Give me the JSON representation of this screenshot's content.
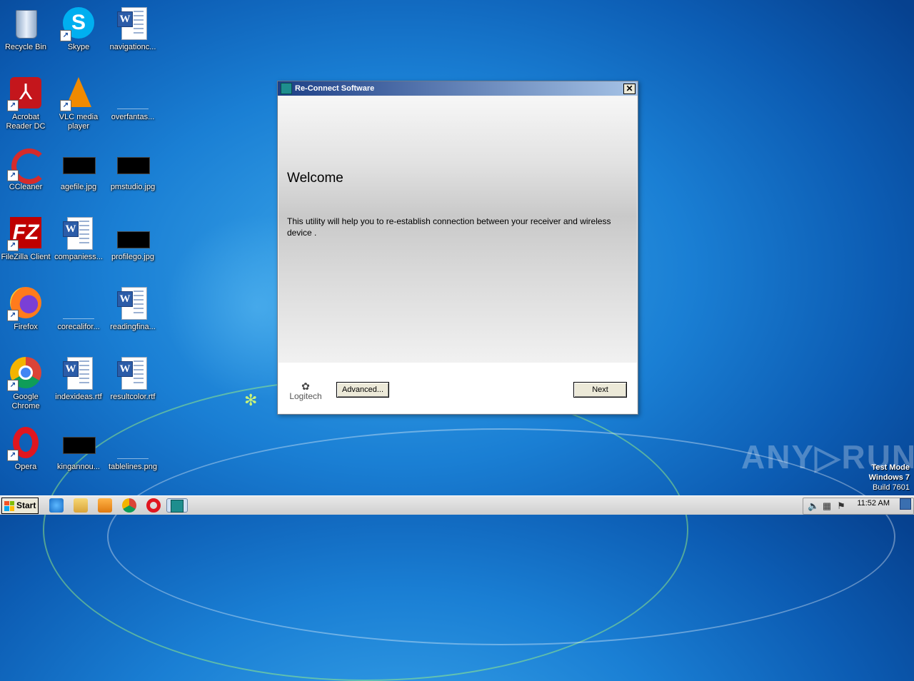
{
  "desktop_icons": [
    {
      "label": "Recycle Bin"
    },
    {
      "label": "Skype"
    },
    {
      "label": "navigationc..."
    },
    {
      "label": "Acrobat Reader DC"
    },
    {
      "label": "VLC media player"
    },
    {
      "label": "overfantas..."
    },
    {
      "label": "CCleaner"
    },
    {
      "label": "agefile.jpg"
    },
    {
      "label": "pmstudio.jpg"
    },
    {
      "label": "FileZilla Client"
    },
    {
      "label": "companiess..."
    },
    {
      "label": "profilego.jpg"
    },
    {
      "label": "Firefox"
    },
    {
      "label": "corecalifor..."
    },
    {
      "label": "readingfina..."
    },
    {
      "label": "Google Chrome"
    },
    {
      "label": "indexideas.rtf"
    },
    {
      "label": "resultcolor.rtf"
    },
    {
      "label": "Opera"
    },
    {
      "label": "kingannou..."
    },
    {
      "label": "tablelines.png"
    }
  ],
  "dialog": {
    "title": "Re-Connect Software",
    "close_glyph": "✕",
    "heading": "Welcome",
    "description": "This utility will help you to re-establish connection between your receiver and wireless device .",
    "logo_text": "Logitech",
    "advanced_label": "Advanced...",
    "next_label": "Next"
  },
  "watermark": {
    "text": "ANY▷RUN"
  },
  "system": {
    "line1": "Test Mode",
    "line2": "Windows 7",
    "line3": "Build 7601"
  },
  "taskbar": {
    "start_label": "Start",
    "clock": "11:52 AM"
  },
  "colors": {
    "desktop": "#1a7fd4",
    "titlebar_start": "#1d3f86",
    "titlebar_end": "#a6c3e6",
    "button_face": "#ece9d8"
  }
}
